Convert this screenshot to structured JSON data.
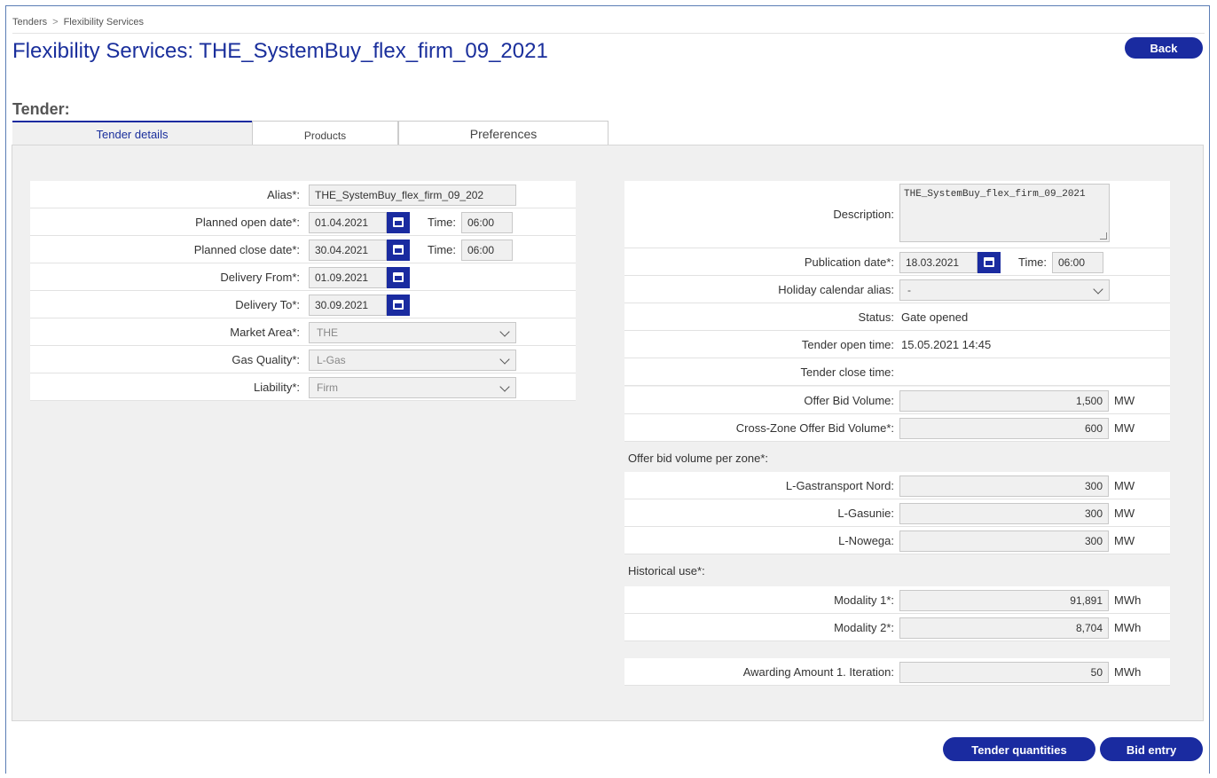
{
  "breadcrumb": {
    "items": [
      "Tenders",
      "Flexibility Services"
    ],
    "sep": ">"
  },
  "page_title": "Flexibility Services: THE_SystemBuy_flex_firm_09_2021",
  "buttons": {
    "back": "Back",
    "tender_quantities": "Tender quantities",
    "bid_entry": "Bid entry"
  },
  "section_title": "Tender:",
  "tabs": [
    "Tender details",
    "Products",
    "Preferences"
  ],
  "left": {
    "alias_label": "Alias*:",
    "alias_value": "THE_SystemBuy_flex_firm_09_202",
    "open_label": "Planned open date*:",
    "open_date": "01.04.2021",
    "open_time": "06:00",
    "close_label": "Planned close date*:",
    "close_date": "30.04.2021",
    "close_time": "06:00",
    "time_label": "Time:",
    "from_label": "Delivery From*:",
    "from_date": "01.09.2021",
    "to_label": "Delivery To*:",
    "to_date": "30.09.2021",
    "market_label": "Market Area*:",
    "market_value": "THE",
    "gas_label": "Gas Quality*:",
    "gas_value": "L-Gas",
    "liability_label": "Liability*:",
    "liability_value": "Firm"
  },
  "right": {
    "desc_label": "Description:",
    "desc_value": "THE_SystemBuy_flex_firm_09_2021",
    "pub_label": "Publication date*:",
    "pub_date": "18.03.2021",
    "pub_time": "06:00",
    "time_label": "Time:",
    "holiday_label": "Holiday calendar alias:",
    "holiday_value": "-",
    "status_label": "Status:",
    "status_value": "Gate opened",
    "open_time_label": "Tender open time:",
    "open_time_value": "15.05.2021 14:45",
    "close_time_label": "Tender close time:",
    "close_time_value": "",
    "offer_label": "Offer Bid Volume:",
    "offer_value": "1,500",
    "offer_unit": "MW",
    "cross_label": "Cross-Zone Offer Bid Volume*:",
    "cross_value": "600",
    "cross_unit": "MW",
    "per_zone_head": "Offer bid volume per zone*:",
    "zones": [
      {
        "label": "L-Gastransport Nord:",
        "value": "300",
        "unit": "MW"
      },
      {
        "label": "L-Gasunie:",
        "value": "300",
        "unit": "MW"
      },
      {
        "label": "L-Nowega:",
        "value": "300",
        "unit": "MW"
      }
    ],
    "hist_head": "Historical use*:",
    "mod1_label": "Modality 1*:",
    "mod1_value": "91,891",
    "mod1_unit": "MWh",
    "mod2_label": "Modality 2*:",
    "mod2_value": "8,704",
    "mod2_unit": "MWh",
    "award_label": "Awarding Amount 1. Iteration:",
    "award_value": "50",
    "award_unit": "MWh"
  }
}
